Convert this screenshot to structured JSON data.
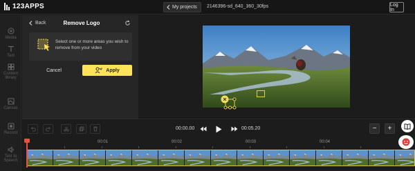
{
  "app": {
    "brand": "123APPS",
    "projects_label": "My projects",
    "file_name": "2146396-sd_640_360_30fps",
    "login_label": "Log In"
  },
  "sidebar": {
    "items": [
      {
        "label": "Media",
        "icon": "media-icon"
      },
      {
        "label": "Text",
        "icon": "text-icon"
      },
      {
        "label": "Content library",
        "icon": "content-library-icon"
      },
      {
        "label": "Canvas",
        "icon": "canvas-icon"
      },
      {
        "label": "Record",
        "icon": "record-icon"
      },
      {
        "label": "Text to Speech",
        "icon": "text-to-speech-icon"
      }
    ]
  },
  "panel": {
    "back_label": "Back",
    "title": "Remove Logo",
    "instructions": "Select one or more areas you wish to remove from your video",
    "cancel_label": "Cancel",
    "apply_label": "Apply"
  },
  "playback": {
    "current_time": "00:00.00",
    "end_time": "00:05.20"
  },
  "ruler": {
    "ticks": [
      "00:01",
      "00:02",
      "00:03",
      "00:04"
    ]
  },
  "colors": {
    "accent": "#fde25a",
    "playhead": "#e5533d",
    "selection": "#e8d14d"
  }
}
